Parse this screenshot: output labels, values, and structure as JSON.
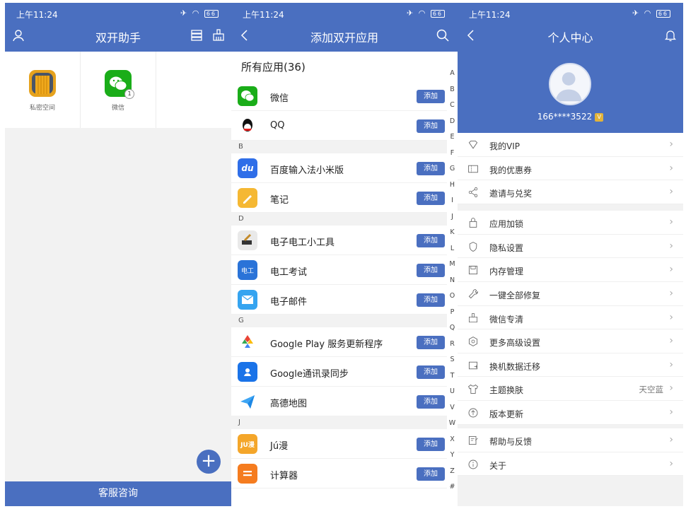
{
  "panel1": {
    "status_time": "上午11:24",
    "battery": "66",
    "title": "双开助手",
    "apps": [
      {
        "label": "私密空间",
        "icon": "folder-icon",
        "color": "#e6a21d"
      },
      {
        "label": "微信",
        "icon": "wechat-icon",
        "color": "#1aad19",
        "badge": "1"
      }
    ],
    "bottom_button": "客服咨询",
    "fab": "+"
  },
  "panel2": {
    "status_time": "上午11:24",
    "battery": "66",
    "title": "添加双开应用",
    "count_title": "所有应用(36)",
    "add_label": "添加",
    "sections": [
      {
        "letter": "",
        "apps": [
          {
            "name": "微信",
            "icon": "wechat-icon",
            "color": "#1aad19"
          },
          {
            "name": "QQ",
            "icon": "qq-icon",
            "color": "#ffffff"
          }
        ]
      },
      {
        "letter": "B",
        "apps": [
          {
            "name": "百度输入法小米版",
            "icon": "baidu-input-icon",
            "color": "#2f6ee8"
          },
          {
            "name": "笔记",
            "icon": "notes-icon",
            "color": "#f5b833"
          }
        ]
      },
      {
        "letter": "D",
        "apps": [
          {
            "name": "电子电工小工具",
            "icon": "tools-icon",
            "color": "#e9e9e9"
          },
          {
            "name": "电工考试",
            "icon": "exam-icon",
            "color": "#2a73d8"
          },
          {
            "name": "电子邮件",
            "icon": "mail-icon",
            "color": "#35a4f0"
          }
        ]
      },
      {
        "letter": "G",
        "apps": [
          {
            "name": "Google Play 服务更新程序",
            "icon": "google-play-icon",
            "color": "#ffffff"
          },
          {
            "name": "Google通讯录同步",
            "icon": "contacts-icon",
            "color": "#1a73e8"
          },
          {
            "name": "高德地图",
            "icon": "amap-icon",
            "color": "#ffffff"
          }
        ]
      },
      {
        "letter": "J",
        "apps": [
          {
            "name": "Jú漫",
            "icon": "juman-icon",
            "color": "#f4a62a"
          },
          {
            "name": "计算器",
            "icon": "calculator-icon",
            "color": "#f57c1f"
          }
        ]
      }
    ],
    "alphabet": [
      "A",
      "B",
      "C",
      "D",
      "E",
      "F",
      "G",
      "H",
      "I",
      "J",
      "K",
      "L",
      "M",
      "N",
      "O",
      "P",
      "Q",
      "R",
      "S",
      "T",
      "U",
      "V",
      "W",
      "X",
      "Y",
      "Z",
      "#"
    ]
  },
  "panel3": {
    "status_time": "上午11:24",
    "battery": "66",
    "title": "个人中心",
    "phone": "166****3522",
    "groups": [
      [
        {
          "label": "我的VIP",
          "icon": "vip-diamond-icon"
        },
        {
          "label": "我的优惠券",
          "icon": "coupon-icon"
        },
        {
          "label": "邀请与兑奖",
          "icon": "share-icon"
        }
      ],
      [
        {
          "label": "应用加锁",
          "icon": "lock-icon"
        },
        {
          "label": "隐私设置",
          "icon": "privacy-shield-icon"
        },
        {
          "label": "内存管理",
          "icon": "memory-icon"
        },
        {
          "label": "一键全部修复",
          "icon": "wrench-icon"
        },
        {
          "label": "微信专清",
          "icon": "clean-broom-icon"
        }
      ],
      [
        {
          "label": "更多高级设置",
          "icon": "settings-gear-icon"
        },
        {
          "label": "换机数据迁移",
          "icon": "migrate-icon"
        },
        {
          "label": "主题换肤",
          "icon": "shirt-icon",
          "value": "天空蓝"
        },
        {
          "label": "版本更新",
          "icon": "update-icon"
        }
      ],
      [
        {
          "label": "帮助与反馈",
          "icon": "feedback-icon"
        },
        {
          "label": "关于",
          "icon": "info-icon"
        }
      ]
    ]
  },
  "colors": {
    "accent": "#4a6fc0",
    "background": "#f2f2f2"
  }
}
